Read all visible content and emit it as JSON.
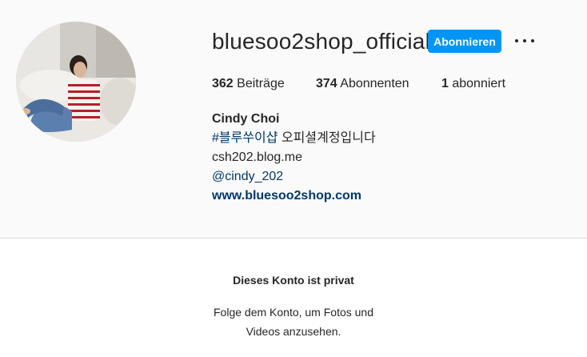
{
  "profile": {
    "username": "bluesoo2shop_official",
    "follow_label": "Abonnieren",
    "more_icon": "more-options-icon"
  },
  "stats": {
    "posts_count": "362",
    "posts_label": "Beiträge",
    "followers_count": "374",
    "followers_label": "Abonnenten",
    "following_count": "1",
    "following_label": "abonniert"
  },
  "bio": {
    "full_name": "Cindy Choi",
    "hashtag": "#블루쑤이샵",
    "hashtag_suffix": " 오피셜계정입니다",
    "line2": "csh202.blog.me",
    "mention": "@cindy_202",
    "website": "www.bluesoo2shop.com"
  },
  "private_notice": {
    "title": "Dieses Konto ist privat",
    "line1": "Folge dem Konto, um Fotos und",
    "line2": "Videos anzusehen."
  },
  "colors": {
    "accent": "#0095f6",
    "link": "#00376b",
    "background": "#fafafa"
  }
}
